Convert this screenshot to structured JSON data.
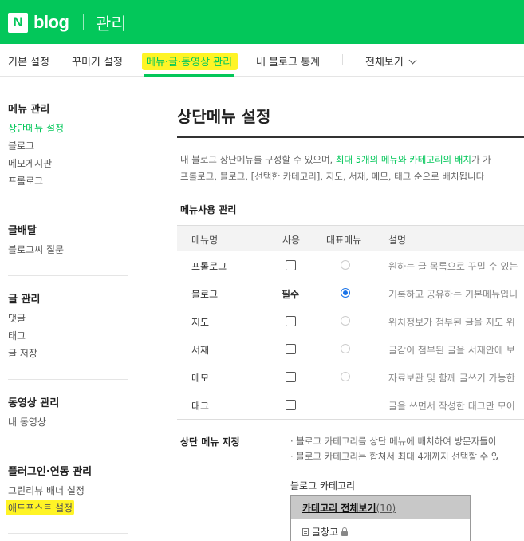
{
  "header": {
    "logo_letter": "N",
    "logo_text": "blog",
    "title": "관리",
    "brand_color": "#03c75a"
  },
  "tabs": [
    {
      "label": "기본 설정"
    },
    {
      "label": "꾸미기 설정"
    },
    {
      "label": "메뉴·글·동영상 관리",
      "active": true
    },
    {
      "label": "내 블로그 통계"
    },
    {
      "label": "전체보기"
    }
  ],
  "sidebar": {
    "sections": [
      {
        "title": "메뉴 관리",
        "items": [
          "상단메뉴 설정",
          "블로그",
          "메모게시판",
          "프롤로그"
        ],
        "active_item": "상단메뉴 설정"
      },
      {
        "title": "글배달",
        "items": [
          "블로그씨 질문"
        ]
      },
      {
        "title": "글 관리",
        "items": [
          "댓글",
          "태그",
          "글 저장"
        ]
      },
      {
        "title": "동영상 관리",
        "items": [
          "내 동영상"
        ]
      },
      {
        "title": "플러그인·연동 관리",
        "items": [
          "그린리뷰 배너 설정",
          "애드포스트 설정"
        ]
      }
    ]
  },
  "main": {
    "title": "상단메뉴 설정",
    "desc_line1_a": "내 블로그 상단메뉴를 구성할 수 있으며, ",
    "desc_line1_b": "최대 5개의 메뉴와 카테고리의 배치",
    "desc_line1_c": "가 가",
    "desc_line2": "프롤로그, 블로그, [선택한 카테고리], 지도, 서재, 메모, 태그 순으로 배치됩니다",
    "menu_use_title": "메뉴사용 관리",
    "table": {
      "headers": [
        "메뉴명",
        "사용",
        "대표메뉴",
        "설명"
      ],
      "rows": [
        {
          "name": "프롤로그",
          "use": "checkbox",
          "rep": "disabled",
          "desc": "원하는 글 목록으로 꾸밀 수 있는"
        },
        {
          "name": "블로그",
          "use": "필수",
          "rep": "selected",
          "desc": "기록하고 공유하는 기본메뉴입니"
        },
        {
          "name": "지도",
          "use": "checkbox",
          "rep": "disabled",
          "desc": "위치정보가 첨부된 글을 지도 위"
        },
        {
          "name": "서재",
          "use": "checkbox",
          "rep": "disabled",
          "desc": "글감이 첨부된 글을 서재안에 보"
        },
        {
          "name": "메모",
          "use": "checkbox",
          "rep": "disabled",
          "desc": "자료보관 및 함께 글쓰기 가능한"
        },
        {
          "name": "태그",
          "use": "checkbox",
          "rep": "none",
          "desc": "글을 쓰면서 작성한 태그만 모이"
        }
      ]
    },
    "top_menu_spec_title": "상단 메뉴 지정",
    "note1": "· 블로그 카테고리를 상단 메뉴에 배치하여 방문자들이",
    "note2": "· 블로그 카테고리는 합쳐서 최대 4개까지 선택할 수 있",
    "category_label": "블로그 카테고리",
    "category_all": "카테고리 전체보기",
    "category_all_count": "(10)",
    "category_items": [
      "글창고"
    ]
  }
}
